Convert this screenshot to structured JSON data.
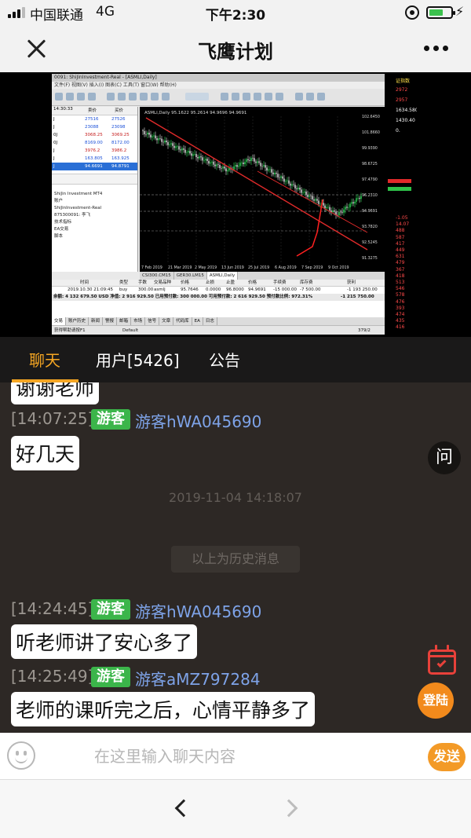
{
  "status_bar": {
    "carrier": "中国联通",
    "network": "4G",
    "time": "下午2:30",
    "charging": "⚡"
  },
  "header": {
    "title": "飞鹰计划"
  },
  "video": {
    "window_title": "0091: ShiJinInvestment-Real - [ASMLI,Daily]",
    "menu": "文件(F)  视图(V)  插入(I)  图表(C)  工具(T)  窗口(W)  帮助(H)",
    "market_watch_time": "14:30:33",
    "market_watch_headers": [
      "卖价",
      "买价"
    ],
    "market_watch": [
      {
        "symbol": "J",
        "bid": "27516",
        "ask": "27526",
        "trend": "up"
      },
      {
        "symbol": "J",
        "bid": "23088",
        "ask": "23098",
        "trend": "up"
      },
      {
        "symbol": "0J",
        "bid": "3068.25",
        "ask": "3069.25",
        "trend": "down"
      },
      {
        "symbol": "0J",
        "bid": "8169.00",
        "ask": "8172.00",
        "trend": "up"
      },
      {
        "symbol": "J",
        "bid": "3976.2",
        "ask": "3986.2",
        "trend": "down"
      },
      {
        "symbol": "J",
        "bid": "163.805",
        "ask": "163.925",
        "trend": "up"
      },
      {
        "symbol": "J",
        "bid": "94.6691",
        "ask": "94.8791",
        "trend": "selected"
      }
    ],
    "navigator": [
      "ShiJin Investment MT4",
      "账户",
      "ShiJinInvestment-Real",
      "875300091: 李飞",
      "技术指标",
      "EA交易",
      "脚本"
    ],
    "chart_label": "ASMLI,Daily  95.1622 95.2614 94.9696 94.9691",
    "chart_tabs": [
      "CSI300.CM15",
      "GER30.LM15",
      "ASMLI,Daily"
    ],
    "chart_dates": [
      "7 Feb 2019",
      "21 Mar 2019",
      "2 May 2019",
      "13 Jun 2019",
      "25 Jul 2019",
      "6 Aug 2019",
      "7 Sep 2019",
      "9 Oct 2019"
    ],
    "price_axis": [
      "102.6450",
      "101.8660",
      "99.9390",
      "98.6725",
      "97.4790",
      "96.2310",
      "94.9691",
      "93.7820",
      "92.5245",
      "91.3275"
    ],
    "terminal_headers": [
      "时间",
      "类型",
      "手数",
      "交易品种",
      "价格",
      "止损",
      "止盈",
      "价格",
      "手续费",
      "库存费",
      "获利"
    ],
    "terminal_row": [
      "2019.10.30 21:09:45",
      "buy",
      "300.00",
      "asmlj",
      "95.7646",
      "0.0000",
      "96.8000",
      "94.9691",
      "-15 000.00",
      "-7 500.00",
      "-1 193 250.00"
    ],
    "terminal_balance": "余额: 4 132 679.50 USD  净值: 2 916 929.50  已用预付款: 300 000.00  可用预付款: 2 616 929.50  预付款比例: 972.31%",
    "terminal_balance_profit": "-1 215 750.00",
    "terminal_tabs": [
      "交易",
      "账户历史",
      "新闻",
      "警报",
      "邮箱",
      "市场",
      "信号",
      "文章",
      "代码库",
      "EA",
      "日志"
    ],
    "status_left": "获得帮助请按F1",
    "status_mid": "Default",
    "status_right": "379/2",
    "right_strip": [
      {
        "text": "证指数",
        "color": "y"
      },
      {
        "text": "2972",
        "color": "r"
      },
      {
        "text": "2957",
        "color": "r"
      },
      {
        "text": "1634.580",
        "color": "w"
      },
      {
        "text": "1430.40",
        "color": "w"
      },
      {
        "text": "0.",
        "color": "w"
      },
      {
        "text": "-1.05",
        "color": "r"
      },
      {
        "text": "14.07",
        "color": "r"
      },
      {
        "text": "488",
        "color": "r"
      },
      {
        "text": "587",
        "color": "r"
      },
      {
        "text": "417",
        "color": "r"
      },
      {
        "text": "449",
        "color": "r"
      },
      {
        "text": "631",
        "color": "r"
      },
      {
        "text": "479",
        "color": "r"
      },
      {
        "text": "367",
        "color": "r"
      },
      {
        "text": "418",
        "color": "r"
      },
      {
        "text": "513",
        "color": "r"
      },
      {
        "text": "546",
        "color": "r"
      },
      {
        "text": "578",
        "color": "r"
      },
      {
        "text": "476",
        "color": "r"
      },
      {
        "text": "393",
        "color": "r"
      },
      {
        "text": "474",
        "color": "r"
      },
      {
        "text": "435",
        "color": "r"
      },
      {
        "text": "416",
        "color": "r"
      }
    ]
  },
  "tabs": [
    {
      "label": "聊天",
      "active": true
    },
    {
      "label": "用户[5426]",
      "active": false
    },
    {
      "label": "公告",
      "active": false
    }
  ],
  "chat": {
    "partial_bubble": "谢谢老师",
    "messages": [
      {
        "time": "[14:07:25]",
        "badge": "游客",
        "user": "游客hWA045690",
        "text": "好几天"
      }
    ],
    "divider_time": "2019-11-04 14:18:07",
    "history_label": "以上为历史消息",
    "recent": [
      {
        "time": "[14:24:45]",
        "badge": "游客",
        "user": "游客hWA045690",
        "text": "听老师讲了安心多了"
      },
      {
        "time": "[14:25:49]",
        "badge": "游客",
        "user": "游客aMZ797284",
        "text": "老师的课听完之后，心情平静多了"
      }
    ],
    "ask_label": "问",
    "login_label": "登陆"
  },
  "input": {
    "placeholder": "在这里输入聊天内容",
    "send_label": "发送"
  },
  "colors": {
    "accent": "#f5a623",
    "chat_bg": "#2d2825",
    "guest_badge": "#3bb54a",
    "username": "#7ea3e8"
  }
}
